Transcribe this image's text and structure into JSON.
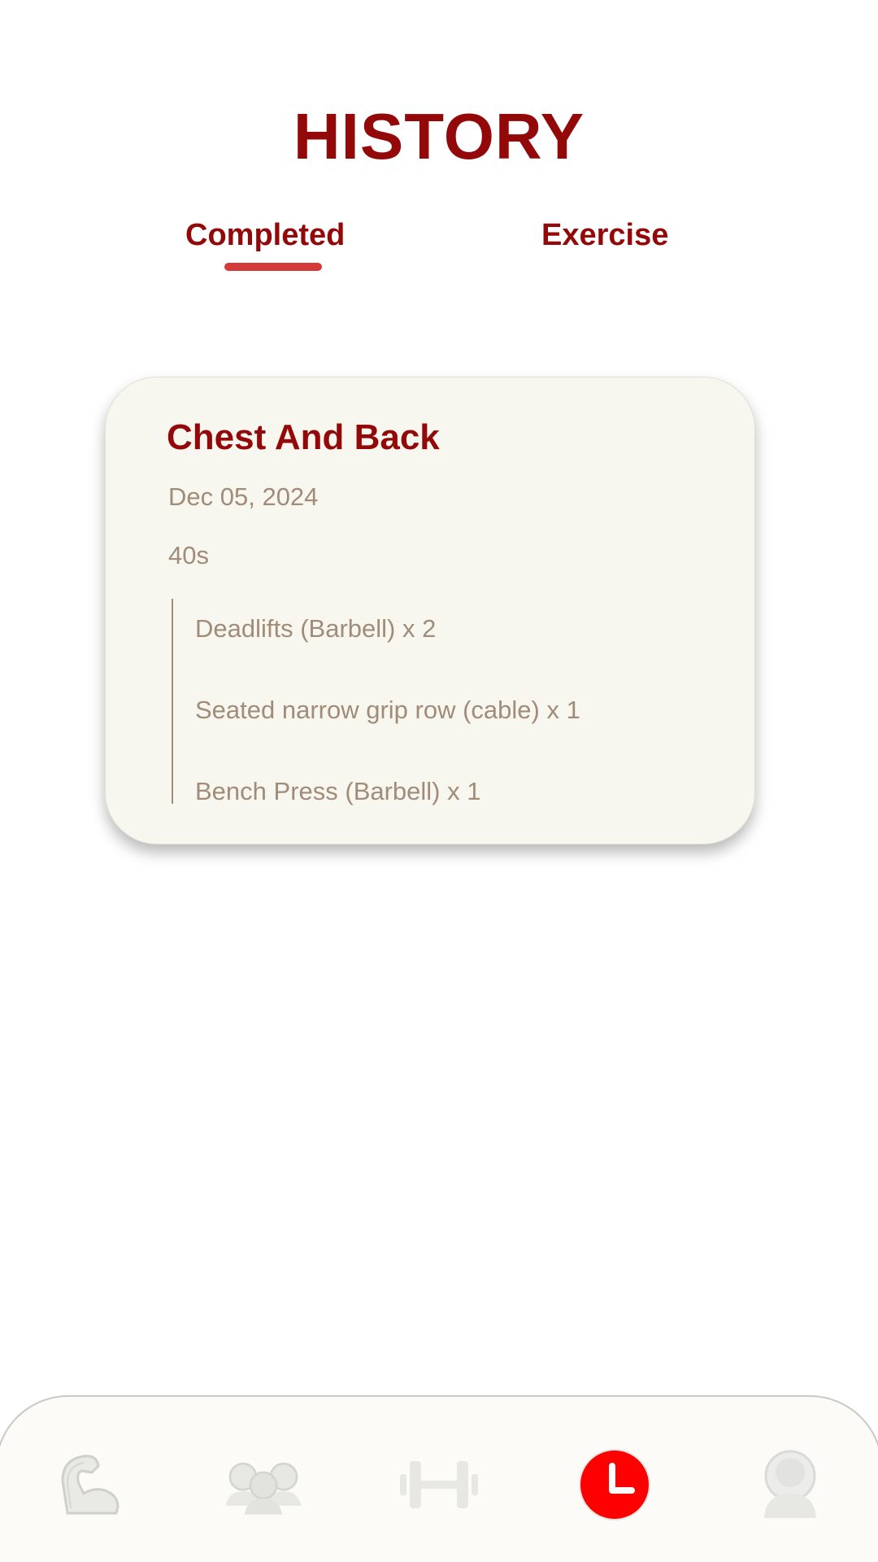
{
  "header": {
    "title": "HISTORY"
  },
  "tabs": [
    {
      "label": "Completed",
      "active": true
    },
    {
      "label": "Exercise",
      "active": false
    }
  ],
  "workouts": [
    {
      "title": "Chest And Back",
      "date": "Dec 05, 2024",
      "duration": "40s",
      "exercises": [
        "Deadlifts (Barbell) x 2",
        "Seated narrow grip row (cable) x 1",
        "Bench Press (Barbell) x 1"
      ]
    }
  ],
  "bottom_nav": {
    "items": [
      {
        "icon": "flexed-arm-icon",
        "active": false
      },
      {
        "icon": "group-icon",
        "active": false
      },
      {
        "icon": "dumbbell-icon",
        "active": false
      },
      {
        "icon": "clock-icon",
        "active": true
      },
      {
        "icon": "profile-icon",
        "active": false
      }
    ]
  },
  "colors": {
    "accent": "#930808",
    "underline": "#d43a3a",
    "card_background": "#f8f7ef",
    "secondary_text": "#a08c78",
    "active_nav": "#ff0000",
    "inactive_nav": "#d6d6d3"
  }
}
